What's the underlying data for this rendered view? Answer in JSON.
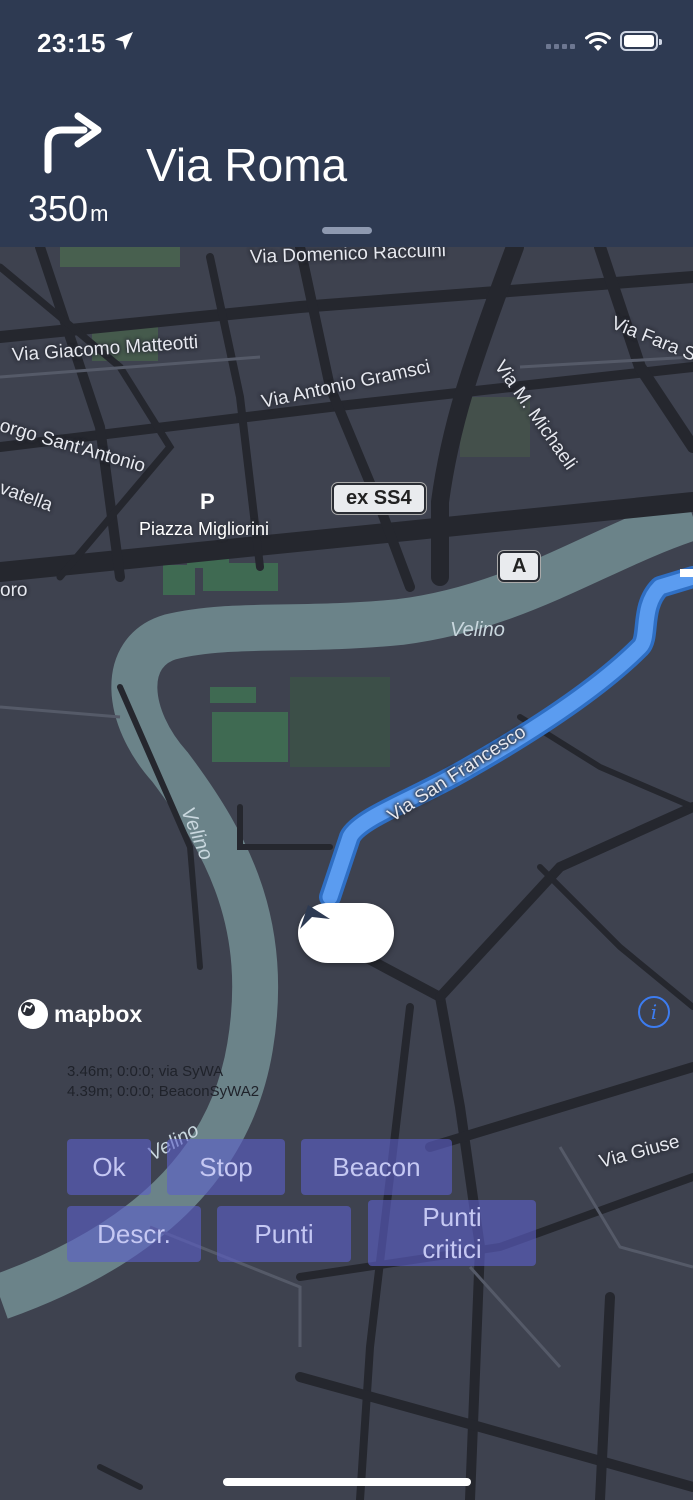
{
  "status_bar": {
    "time": "23:15",
    "location_icon": "location-arrow-icon",
    "signal_icon": "cellular-signal-icon",
    "wifi_icon": "wifi-icon",
    "battery_icon": "battery-icon"
  },
  "instruction": {
    "maneuver_icon": "turn-right-arrow-icon",
    "distance_value": "350",
    "distance_unit": "m",
    "street_name": "Via Roma"
  },
  "map": {
    "street_labels": [
      "Via Domenico Raccuini",
      "Via Giacomo Matteotti",
      "Via Antonio Gramsci",
      "Via M. Michaeli",
      "Via Fara S",
      "orgo Sant'Antonio",
      "vatella",
      "oro",
      "Via San Francesco",
      "Via Giuse"
    ],
    "river_labels": [
      "Velino",
      "Velino",
      "Velino"
    ],
    "road_shields": [
      "ex SS4",
      "A"
    ],
    "parking_symbol": "P",
    "poi_label": "Piazza Migliorini",
    "attribution": "mapbox",
    "info_symbol": "i",
    "route_color": "#4a90e2"
  },
  "debug": {
    "line1": "3.46m; 0:0:0;  via SyWA",
    "line2": "4.39m; 0:0:0; BeaconSyWA2"
  },
  "controls": {
    "ok": "Ok",
    "stop": "Stop",
    "beacon": "Beacon",
    "descr": "Descr.",
    "punti": "Punti",
    "punti_critici_line1": "Punti",
    "punti_critici_line2": "critici"
  }
}
